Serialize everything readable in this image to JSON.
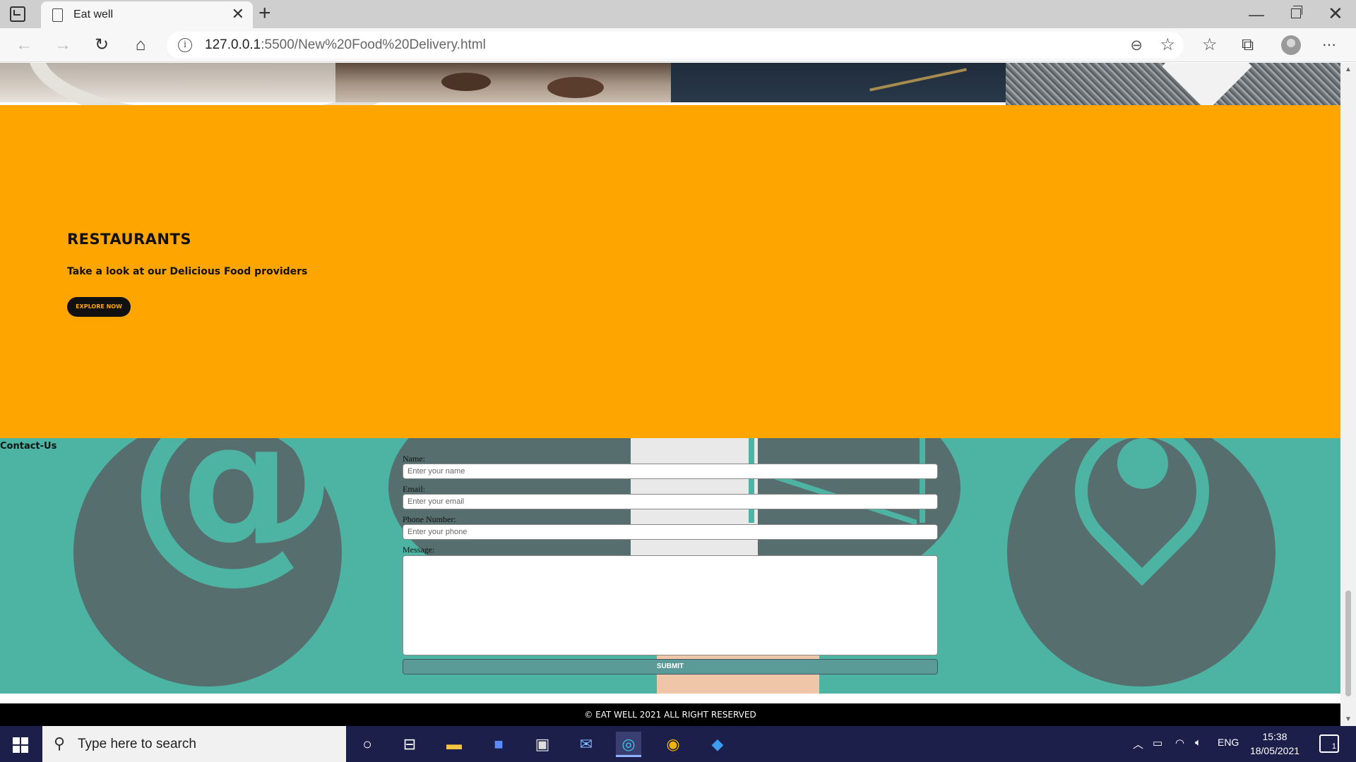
{
  "browser": {
    "tab_title": "Eat well",
    "tab_close": "✕",
    "new_tab": "+",
    "url_host": "127.0.0.1",
    "url_path": ":5500/New%20Food%20Delivery.html",
    "info_glyph": "i"
  },
  "page": {
    "restaurants": {
      "title": "RESTAURANTS",
      "subtitle": "Take a look at our Delicious Food providers",
      "button": "EXPLORE NOW"
    },
    "contact": {
      "label": "Contact-Us",
      "name_label": "Name:",
      "name_placeholder": "Enter your name",
      "email_label": "Email:",
      "email_placeholder": "Enter your email",
      "phone_label": "Phone Number:",
      "phone_placeholder": "Enter your phone",
      "message_label": "Message:",
      "submit": "SUBMIT"
    },
    "footer": "© EAT WELL 2021 ALL RIGHT RESERVED"
  },
  "taskbar": {
    "search_placeholder": "Type here to search",
    "language": "ENG",
    "time": "15:38",
    "date": "18/05/2021",
    "notifications": "1"
  },
  "colors": {
    "restaurants_bg": "#ffa500",
    "contact_bg": "#4db3a3",
    "footer_bg": "#000000",
    "taskbar_bg": "#1c1f4a"
  }
}
